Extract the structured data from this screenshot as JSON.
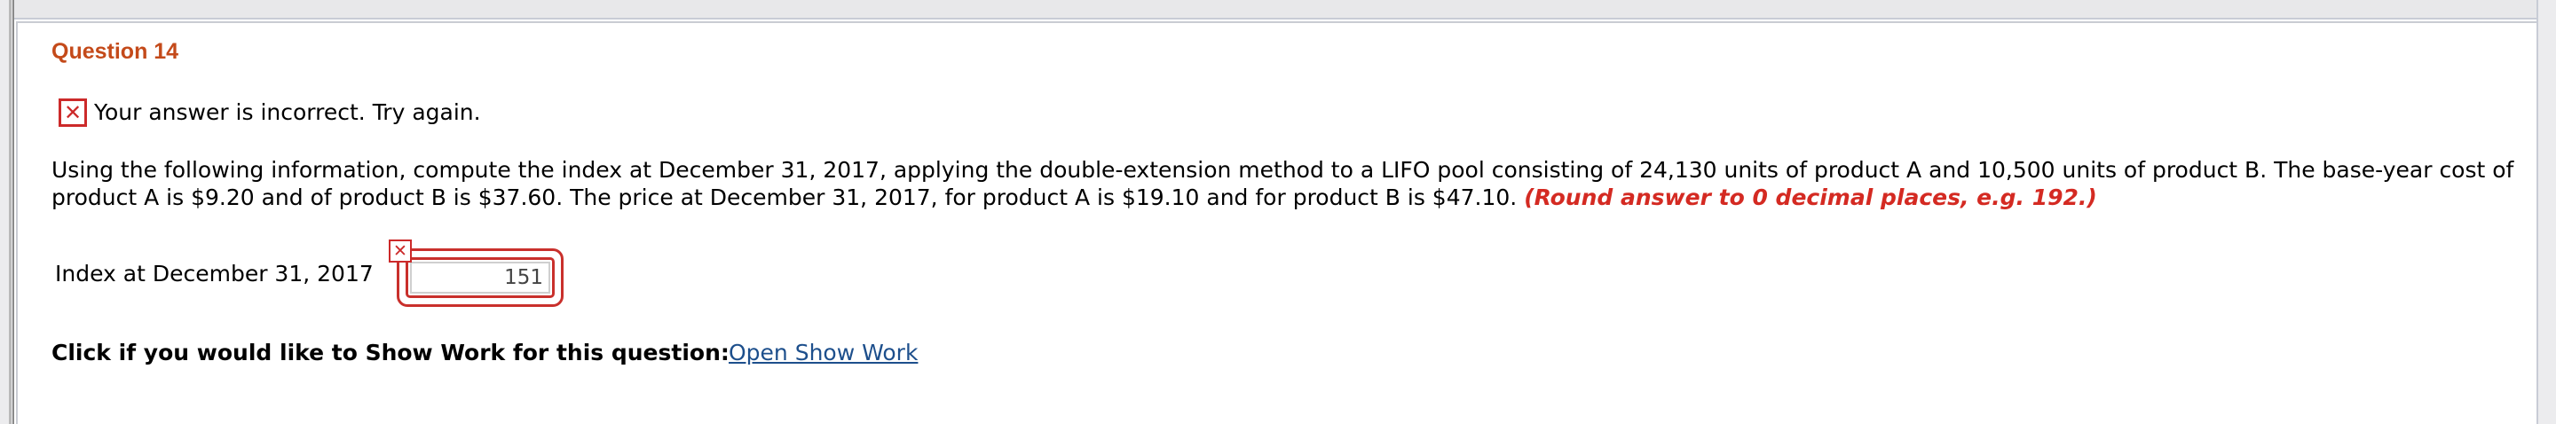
{
  "question": {
    "title": "Question 14"
  },
  "feedback": {
    "icon": "error-x-icon",
    "message": "Your answer is incorrect.  Try again."
  },
  "problem": {
    "text": "Using the following information, compute the index at December 31, 2017, applying the double-extension method to a LIFO pool consisting of 24,130 units of product A and 10,500 units of product B. The base-year cost of product A is $9.20 and of product B is $37.60. The price at December 31, 2017, for product A is $19.10 and for product B is $47.10.",
    "hint": "(Round answer to 0 decimal places, e.g. 192.)"
  },
  "answer": {
    "label": "Index at December 31, 2017",
    "value": "151",
    "status_icon": "incorrect-x-icon"
  },
  "show_work": {
    "label": "Click if you would like to Show Work for this question:",
    "link": "Open Show Work"
  },
  "colors": {
    "title": "#c44a1a",
    "error": "#cc2a2a",
    "hint": "#d42a22",
    "link": "#1d4f8c"
  }
}
